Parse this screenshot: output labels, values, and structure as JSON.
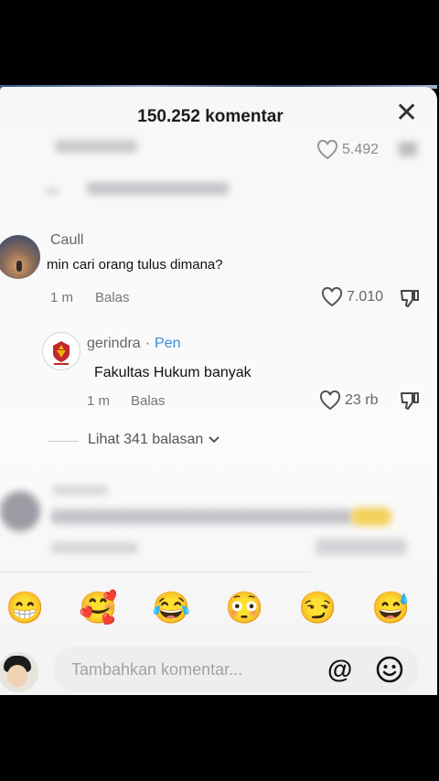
{
  "header": {
    "title": "150.252 komentar"
  },
  "blurred_top": {
    "likes": "5.492"
  },
  "comments": [
    {
      "user": "Caull",
      "text": "min cari orang tulus dimana?",
      "time": "1 m",
      "reply_label": "Balas",
      "likes": "7.010"
    }
  ],
  "reply": {
    "user": "gerindra",
    "badge_sep": "·",
    "badge": "Pen",
    "text": "Fakultas Hukum banyak",
    "time": "1 m",
    "reply_label": "Balas",
    "likes": "23 rb"
  },
  "view_replies": "Lihat 341 balasan",
  "emojis": [
    "😁",
    "🥰",
    "😂",
    "😳",
    "😏",
    "😅"
  ],
  "composer": {
    "placeholder": "Tambahkan komentar...",
    "mention_symbol": "@"
  },
  "colors": {
    "badge": "#3a8bd8",
    "gerindra_red": "#c0272d",
    "gerindra_gold": "#f0b400"
  }
}
